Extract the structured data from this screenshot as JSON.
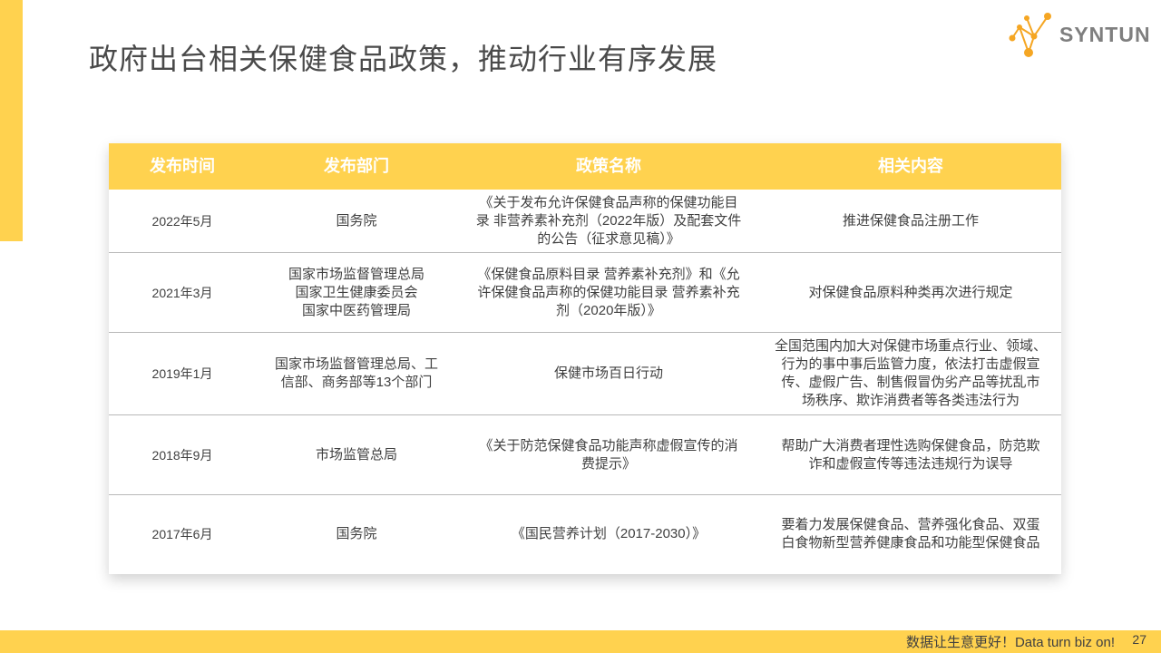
{
  "slide": {
    "title": "政府出台相关保健食品政策，推动行业有序发展",
    "logo_text": "SYNTUN",
    "footer_text": "数据让生意更好！Data  turn  biz  on!",
    "page_number": "27",
    "accent_color": "#FFD24F"
  },
  "table": {
    "headers": [
      "发布时间",
      "发布部门",
      "政策名称",
      "相关内容"
    ],
    "rows": [
      {
        "date": "2022年5月",
        "dept": [
          "国务院"
        ],
        "policy": [
          "《关于发布允许保健食品声称的保健功能目",
          "录 非营养素补充剂（2022年版）及配套文件",
          "的公告（征求意见稿）》"
        ],
        "content": [
          "推进保健食品注册工作"
        ]
      },
      {
        "date": "2021年3月",
        "dept": [
          "国家市场监督管理总局",
          "国家卫生健康委员会",
          "国家中医药管理局"
        ],
        "policy": [
          "《保健食品原料目录 营养素补充剂》和《允",
          "许保健食品声称的保健功能目录 营养素补充",
          "剂（2020年版）》"
        ],
        "content": [
          "对保健食品原料种类再次进行规定"
        ]
      },
      {
        "date": "2019年1月",
        "dept": [
          "国家市场监督管理总局、工",
          "信部、商务部等13个部门"
        ],
        "policy": [
          "保健市场百日行动"
        ],
        "content": [
          "全国范围内加大对保健市场重点行业、领域、",
          "行为的事中事后监管力度，依法打击虚假宣",
          "传、虚假广告、制售假冒伪劣产品等扰乱市",
          "场秩序、欺诈消费者等各类违法行为"
        ]
      },
      {
        "date": "2018年9月",
        "dept": [
          "市场监管总局"
        ],
        "policy": [
          "《关于防范保健食品功能声称虚假宣传的消",
          "费提示》"
        ],
        "content": [
          "帮助广大消费者理性选购保健食品，防范欺",
          "诈和虚假宣传等违法违规行为误导"
        ]
      },
      {
        "date": "2017年6月",
        "dept": [
          "国务院"
        ],
        "policy": [
          "《国民营养计划（2017-2030）》"
        ],
        "content": [
          "要着力发展保健食品、营养强化食品、双蛋",
          "白食物新型营养健康食品和功能型保健食品"
        ]
      }
    ]
  }
}
